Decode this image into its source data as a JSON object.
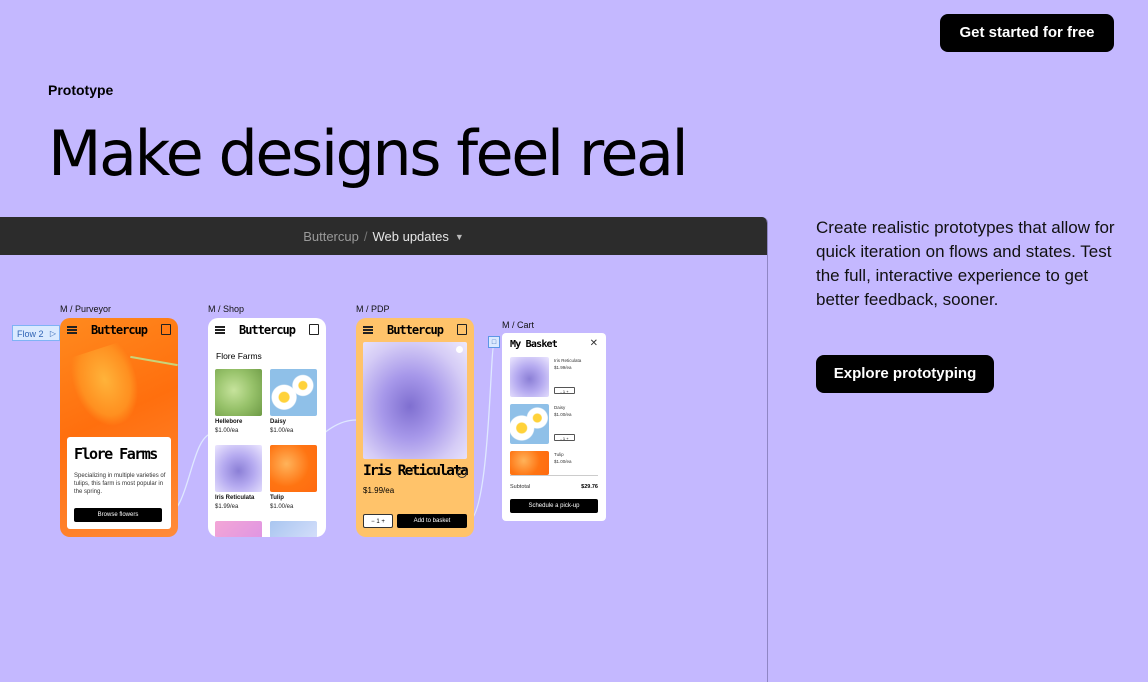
{
  "header": {
    "cta_label": "Get started for free"
  },
  "hero": {
    "eyebrow": "Prototype",
    "headline": "Make designs feel real",
    "description": "Create realistic prototypes that allow for quick iteration on flows and states. Test the full, interactive experience to get better feedback, sooner.",
    "cta_label": "Explore prototyping"
  },
  "editor": {
    "project": "Buttercup",
    "separator": "/",
    "file": "Web updates",
    "flow_label": "Flow 2",
    "frames": {
      "purveyor": {
        "label": "M / Purveyor",
        "brand": "Buttercup",
        "card_title": "Flore Farms",
        "card_text": "Specializing in multiple varieties of tulips, this farm is most popular in the spring.",
        "button": "Browse flowers"
      },
      "shop": {
        "label": "M / Shop",
        "brand": "Buttercup",
        "section_title": "Flore Farms",
        "items": [
          {
            "name": "Hellebore",
            "price": "$1.00/ea"
          },
          {
            "name": "Daisy",
            "price": "$1.00/ea"
          },
          {
            "name": "Iris Reticulata",
            "price": "$1.99/ea"
          },
          {
            "name": "Tulip",
            "price": "$1.00/ea"
          }
        ]
      },
      "pdp": {
        "label": "M / PDP",
        "brand": "Buttercup",
        "title": "Iris Reticulata",
        "price": "$1.99/ea",
        "quantity": "1",
        "button": "Add to basket"
      },
      "cart": {
        "label": "M / Cart",
        "title": "My Basket",
        "items": [
          {
            "name": "Iris Reticulata",
            "price": "$1.99/ea",
            "quantity": "1"
          },
          {
            "name": "Daisy",
            "price": "$1.00/ea",
            "quantity": "1"
          },
          {
            "name": "Tulip",
            "price": "$1.00/ea"
          }
        ],
        "subtotal_label": "Subtotal",
        "subtotal_value": "$29.76",
        "button": "Schedule a pick-up"
      }
    }
  },
  "colors": {
    "background": "#c4b8ff",
    "toolbar": "#2c2c2c",
    "accent_orange": "#ff7412",
    "pdp_background": "#ffc36a"
  }
}
